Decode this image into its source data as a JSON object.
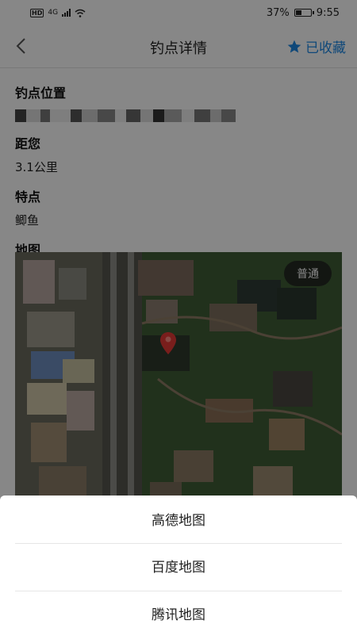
{
  "status_bar": {
    "network_badge": "HD",
    "network_type": "4G",
    "battery": "37%",
    "time": "9:55"
  },
  "header": {
    "title": "钓点详情",
    "favorite_label": "已收藏",
    "accent_color": "#1e88e5"
  },
  "details": {
    "location_label": "钓点位置",
    "distance_label": "距您",
    "distance_value": "3.1公里",
    "feature_label": "特点",
    "feature_value": "鲫鱼",
    "map_label": "地图"
  },
  "map": {
    "type_button": "普通",
    "marker_icon": "map-pin-icon"
  },
  "action_sheet": {
    "items": [
      "高德地图",
      "百度地图",
      "腾讯地图"
    ]
  }
}
